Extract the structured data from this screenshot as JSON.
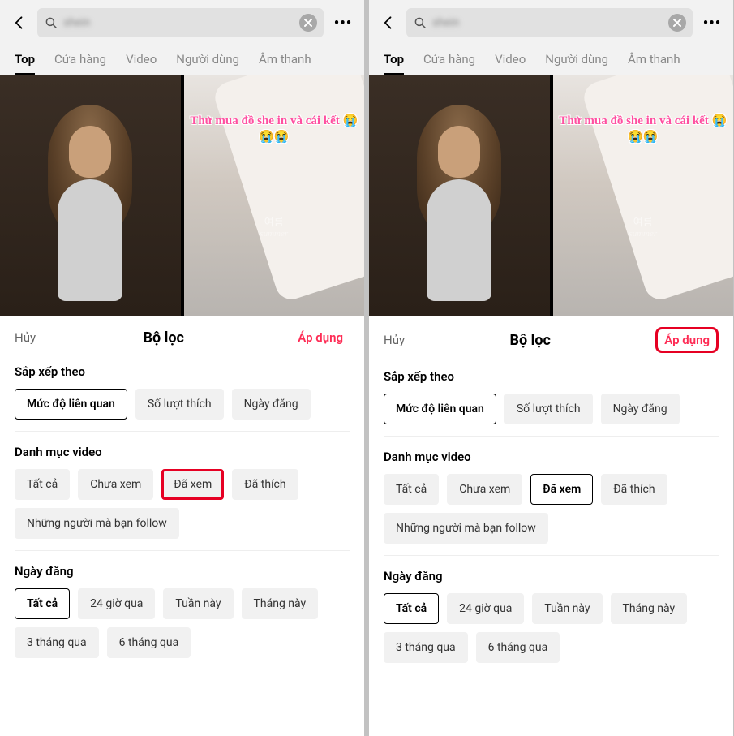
{
  "panels": [
    {
      "header": {
        "search_blur_text": "shein",
        "more": "•••"
      },
      "tabs": [
        {
          "label": "Top",
          "active": true
        },
        {
          "label": "Cửa hàng",
          "active": false
        },
        {
          "label": "Video",
          "active": false
        },
        {
          "label": "Người dùng",
          "active": false
        },
        {
          "label": "Âm thanh",
          "active": false
        }
      ],
      "thumb_right_text": "Thử mua đồ she in và cái kết 😭😭😭",
      "thumb_watermark_main": "여름",
      "thumb_watermark_sub": "summer",
      "sheet": {
        "cancel": "Hủy",
        "title": "Bộ lọc",
        "apply": "Áp dụng",
        "apply_highlight": false,
        "sections": [
          {
            "title": "Sắp xếp theo",
            "chips": [
              {
                "label": "Mức độ liên quan",
                "selected": true,
                "highlight": false
              },
              {
                "label": "Số lượt thích",
                "selected": false,
                "highlight": false
              },
              {
                "label": "Ngày đăng",
                "selected": false,
                "highlight": false
              }
            ]
          },
          {
            "title": "Danh mục video",
            "chips": [
              {
                "label": "Tất cả",
                "selected": false,
                "highlight": false
              },
              {
                "label": "Chưa xem",
                "selected": false,
                "highlight": false
              },
              {
                "label": "Đã xem",
                "selected": false,
                "highlight": true
              },
              {
                "label": "Đã thích",
                "selected": false,
                "highlight": false
              },
              {
                "label": "Những người mà bạn follow",
                "selected": false,
                "highlight": false
              }
            ]
          },
          {
            "title": "Ngày đăng",
            "chips": [
              {
                "label": "Tất cả",
                "selected": true,
                "highlight": false
              },
              {
                "label": "24 giờ qua",
                "selected": false,
                "highlight": false
              },
              {
                "label": "Tuần này",
                "selected": false,
                "highlight": false
              },
              {
                "label": "Tháng này",
                "selected": false,
                "highlight": false
              },
              {
                "label": "3 tháng qua",
                "selected": false,
                "highlight": false
              },
              {
                "label": "6 tháng qua",
                "selected": false,
                "highlight": false
              }
            ]
          }
        ]
      }
    },
    {
      "header": {
        "search_blur_text": "shein",
        "more": "•••"
      },
      "tabs": [
        {
          "label": "Top",
          "active": true
        },
        {
          "label": "Cửa hàng",
          "active": false
        },
        {
          "label": "Video",
          "active": false
        },
        {
          "label": "Người dùng",
          "active": false
        },
        {
          "label": "Âm thanh",
          "active": false
        }
      ],
      "thumb_right_text": "Thử mua đồ she in và cái kết 😭😭😭",
      "thumb_watermark_main": "여름",
      "thumb_watermark_sub": "summer",
      "sheet": {
        "cancel": "Hủy",
        "title": "Bộ lọc",
        "apply": "Áp dụng",
        "apply_highlight": true,
        "sections": [
          {
            "title": "Sắp xếp theo",
            "chips": [
              {
                "label": "Mức độ liên quan",
                "selected": true,
                "highlight": false
              },
              {
                "label": "Số lượt thích",
                "selected": false,
                "highlight": false
              },
              {
                "label": "Ngày đăng",
                "selected": false,
                "highlight": false
              }
            ]
          },
          {
            "title": "Danh mục video",
            "chips": [
              {
                "label": "Tất cả",
                "selected": false,
                "highlight": false
              },
              {
                "label": "Chưa xem",
                "selected": false,
                "highlight": false
              },
              {
                "label": "Đã xem",
                "selected": true,
                "highlight": false
              },
              {
                "label": "Đã thích",
                "selected": false,
                "highlight": false
              },
              {
                "label": "Những người mà bạn follow",
                "selected": false,
                "highlight": false
              }
            ]
          },
          {
            "title": "Ngày đăng",
            "chips": [
              {
                "label": "Tất cả",
                "selected": true,
                "highlight": false
              },
              {
                "label": "24 giờ qua",
                "selected": false,
                "highlight": false
              },
              {
                "label": "Tuần này",
                "selected": false,
                "highlight": false
              },
              {
                "label": "Tháng này",
                "selected": false,
                "highlight": false
              },
              {
                "label": "3 tháng qua",
                "selected": false,
                "highlight": false
              },
              {
                "label": "6 tháng qua",
                "selected": false,
                "highlight": false
              }
            ]
          }
        ]
      }
    }
  ]
}
